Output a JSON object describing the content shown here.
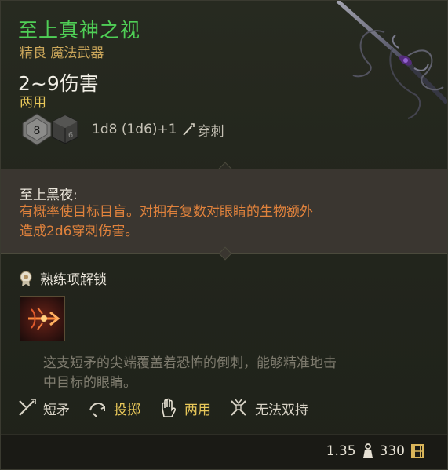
{
  "item": {
    "name": "至上真神之视",
    "rarity": "精良 魔法武器",
    "damage": "2~9伤害",
    "handedness": "两用",
    "dice": {
      "die_main_face": "8",
      "die_alt_face": "6",
      "formula": "1d8 (1d6)+1",
      "damage_type": "穿刺"
    },
    "colors": {
      "name": "#4fcf56",
      "rarity": "#c9a55a",
      "handedness": "#e9c85a",
      "passive_desc": "#e0823c"
    }
  },
  "passive": {
    "title": "至上黑夜:",
    "description_line1": "有概率使目标目盲。对拥有复数对眼睛的生物额外",
    "description_line2": "造成2d6穿刺伤害。"
  },
  "proficiency": {
    "label": "熟练项解锁"
  },
  "flavor": {
    "line1": "这支短矛的尖端覆盖着恐怖的倒刺，能够精准地击",
    "line2": "中目标的眼睛。"
  },
  "properties": [
    {
      "icon": "spear-icon",
      "label": "短矛"
    },
    {
      "icon": "throw-icon",
      "label": "投掷"
    },
    {
      "icon": "hand-icon",
      "label": "两用"
    },
    {
      "icon": "no-dual-wield-icon",
      "label": "无法双持"
    }
  ],
  "footer": {
    "weight": "1.35",
    "value": "330"
  }
}
